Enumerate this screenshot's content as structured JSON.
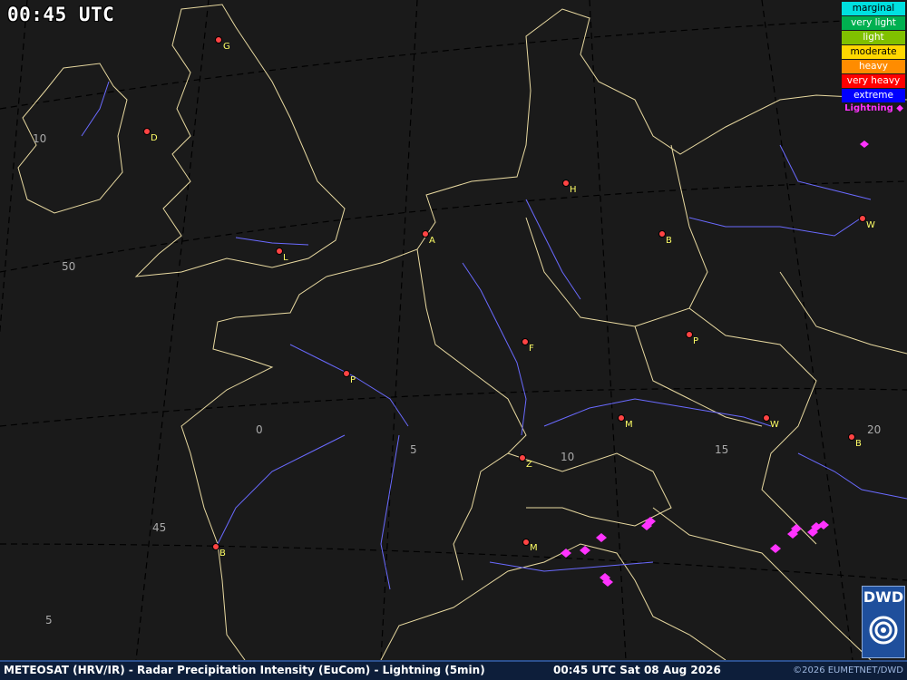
{
  "time_display": "00:45 UTC",
  "legend": {
    "items": [
      {
        "label": "marginal",
        "bg": "#00e0e0",
        "fg": "#000000"
      },
      {
        "label": "very light",
        "bg": "#00b050",
        "fg": "#ffffff"
      },
      {
        "label": "light",
        "bg": "#80c000",
        "fg": "#ffffff"
      },
      {
        "label": "moderate",
        "bg": "#ffd700",
        "fg": "#000000"
      },
      {
        "label": "heavy",
        "bg": "#ff8c00",
        "fg": "#ffffff"
      },
      {
        "label": "very heavy",
        "bg": "#ff0000",
        "fg": "#ffffff"
      },
      {
        "label": "extreme",
        "bg": "#0000ff",
        "fg": "#ffffff"
      }
    ],
    "lightning_label": "Lightning ◆"
  },
  "grid_labels": [
    "10",
    "50",
    "0",
    "5",
    "10",
    "15",
    "20",
    "45",
    "5"
  ],
  "cities": [
    "G",
    "D",
    "A",
    "H",
    "B",
    "W",
    "L",
    "F",
    "P",
    "P",
    "M",
    "W",
    "B",
    "Z",
    "M",
    "B"
  ],
  "footer": {
    "product": "METEOSAT (HRV/IR) - Radar Precipitation Intensity (EuCom) - Lightning (5min)",
    "timestamp": "00:45 UTC Sat 08 Aug 2026",
    "copyright": "©2026 EUMETNET/DWD"
  },
  "logo_text": "DWD",
  "colors": {
    "background": "#1a1a1a",
    "coast": "#e8d9a0",
    "river": "#6a6aff",
    "city": "#ff4444",
    "lightning": "#ff33ff"
  }
}
